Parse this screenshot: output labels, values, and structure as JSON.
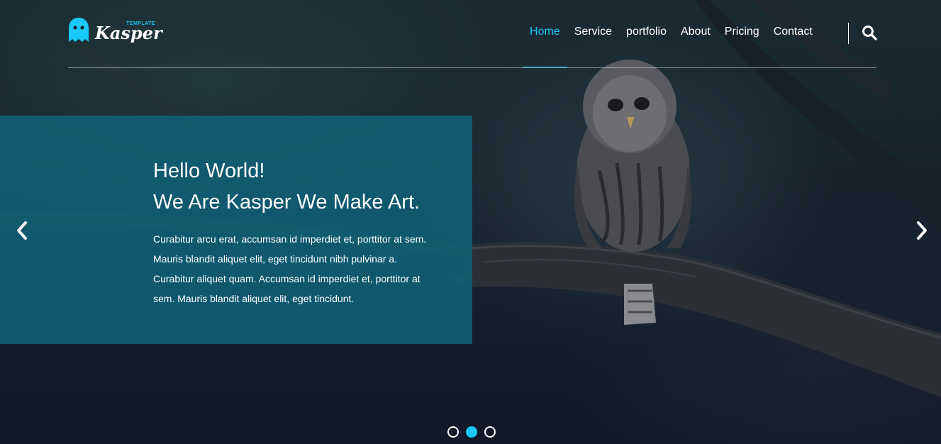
{
  "brand": {
    "name": "Kasper",
    "tagline": "TEMPLATE",
    "accent_color": "#19c8fa",
    "icon": "ghost-icon"
  },
  "nav": {
    "items": [
      {
        "label": "Home",
        "active": true
      },
      {
        "label": "Service",
        "active": false
      },
      {
        "label": "portfolio",
        "active": false
      },
      {
        "label": "About",
        "active": false
      },
      {
        "label": "Pricing",
        "active": false
      },
      {
        "label": "Contact",
        "active": false
      }
    ],
    "search_icon": "search-icon"
  },
  "hero": {
    "title_line1": "Hello World!",
    "title_line2": "We Are Kasper We Make Art.",
    "description": "Curabitur arcu erat, accumsan id imperdiet et, porttitor at sem. Mauris blandit aliquet elit, eget tincidunt nibh pulvinar a. Curabitur aliquet quam. Accumsan id imperdiet et, porttitor at sem. Mauris blandit aliquet elit, eget tincidunt.",
    "panel_color": "#0e6880",
    "prev_icon": "chevron-left-icon",
    "next_icon": "chevron-right-icon"
  },
  "slider": {
    "bullets": [
      {
        "active": false
      },
      {
        "active": true
      },
      {
        "active": false
      }
    ]
  }
}
